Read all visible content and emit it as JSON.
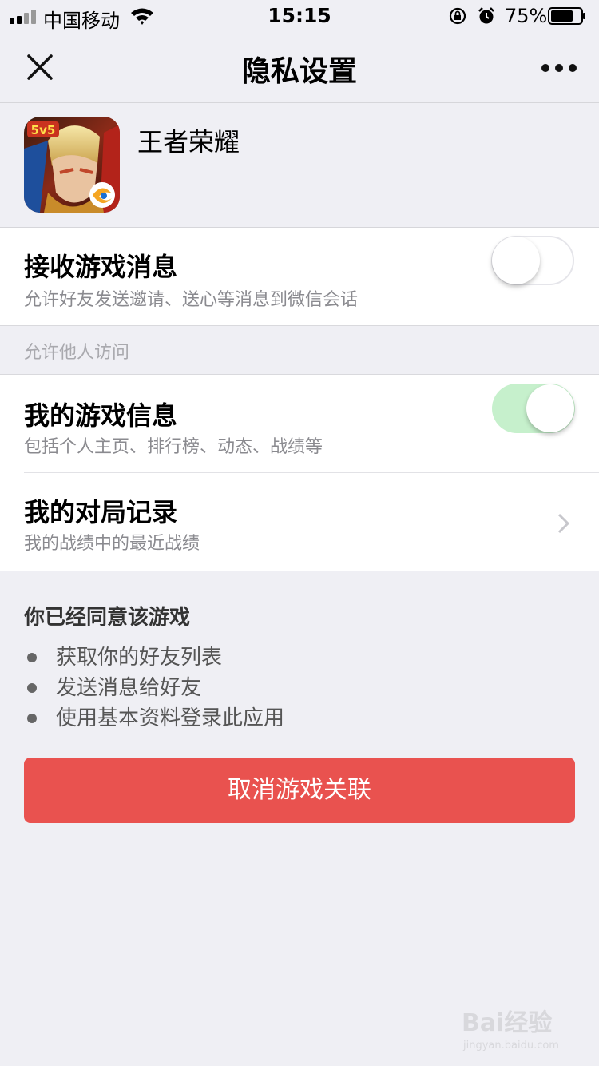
{
  "status_bar": {
    "carrier": "中国移动",
    "time": "15:15",
    "battery_percent": "75%",
    "battery_level": 0.75,
    "icons": [
      "signal-icon",
      "wifi-icon",
      "orientation-lock-icon",
      "alarm-icon",
      "battery-icon"
    ]
  },
  "nav": {
    "title": "隐私设置",
    "close_icon": "close-icon",
    "more_icon": "more-icon"
  },
  "game": {
    "name": "王者荣耀",
    "icon_badge": "5v5"
  },
  "settings": {
    "receive_messages": {
      "title": "接收游戏消息",
      "subtitle": "允许好友发送邀请、送心等消息到微信会话",
      "enabled": false
    },
    "group_label": "允许他人访问",
    "game_info": {
      "title": "我的游戏信息",
      "subtitle": "包括个人主页、排行榜、动态、战绩等",
      "enabled": true
    },
    "match_records": {
      "title": "我的对局记录",
      "subtitle": "我的战绩中的最近战绩"
    }
  },
  "agreement": {
    "title": "你已经同意该游戏",
    "items": [
      "获取你的好友列表",
      "发送消息给好友",
      "使用基本资料登录此应用"
    ]
  },
  "unlink_button": {
    "label": "取消游戏关联",
    "color": "#e9524f"
  },
  "watermark": {
    "text": "Bai经验",
    "url": "jingyan.baidu.com"
  },
  "colors": {
    "background": "#efeff4",
    "switch_on": "#c6f0cc",
    "danger": "#e9524f"
  }
}
